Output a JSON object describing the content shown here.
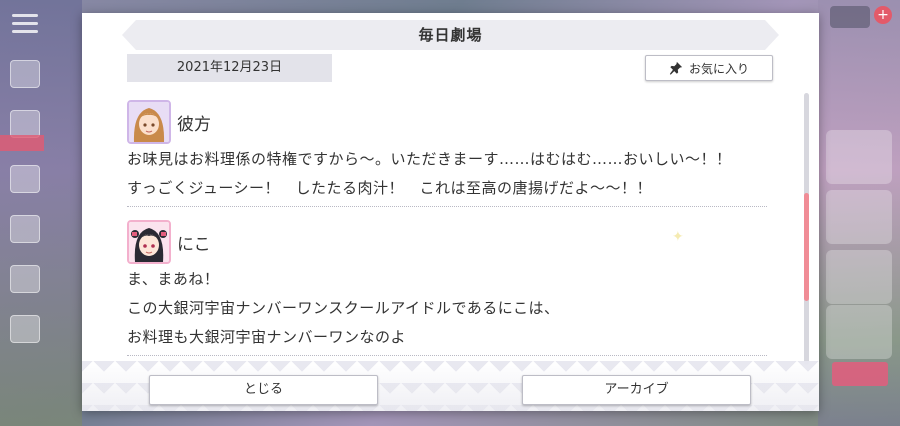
{
  "dialog": {
    "title": "毎日劇場",
    "date": "2021年12月23日",
    "favorite_label": "お気に入り"
  },
  "entries": [
    {
      "speaker": "彼方",
      "lines": [
        "お味見はお料理係の特権ですから〜。いただきまーす……はむはむ……おいしい〜！！",
        "すっごくジューシー！　したたる肉汁！　これは至高の唐揚げだよ〜〜！！"
      ]
    },
    {
      "speaker": "にこ",
      "lines": [
        "ま、まあね！",
        "この大銀河宇宙ナンバーワンスクールアイドルであるにこは、",
        "お料理も大銀河宇宙ナンバーワンなのよ"
      ]
    }
  ],
  "footer": {
    "close_label": "とじる",
    "archive_label": "アーカイブ"
  },
  "colors": {
    "accent": "#f08c96",
    "ribbon": "#ececf1",
    "date_bg": "#e3e3ea"
  },
  "icons": {
    "favorite": "pin-icon",
    "menu": "menu-icon"
  }
}
